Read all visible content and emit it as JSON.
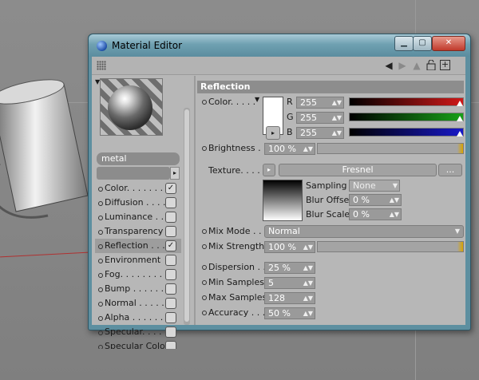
{
  "window": {
    "title": "Material Editor",
    "controls": {
      "minimize": "▁",
      "maximize": "▢",
      "close": "✕"
    }
  },
  "material": {
    "name": "metal"
  },
  "channels": [
    {
      "label": "Color. . . . . . . .",
      "checked": true
    },
    {
      "label": "Diffusion . . . . .",
      "checked": false
    },
    {
      "label": "Luminance . . . .",
      "checked": false
    },
    {
      "label": "Transparency",
      "checked": false
    },
    {
      "label": "Reflection . . . .",
      "checked": true
    },
    {
      "label": "Environment",
      "checked": false
    },
    {
      "label": "Fog. . . . . . . . .",
      "checked": false
    },
    {
      "label": "Bump . . . . . . .",
      "checked": false
    },
    {
      "label": "Normal . . . . . .",
      "checked": false
    },
    {
      "label": "Alpha . . . . . . .",
      "checked": false
    },
    {
      "label": "Specular. . . . . .",
      "checked": false
    },
    {
      "label": "Specular Color",
      "checked": false
    }
  ],
  "section": {
    "title": "Reflection"
  },
  "color": {
    "label": "Color. . . . .",
    "r_label": "R",
    "g_label": "G",
    "b_label": "B",
    "r": "255",
    "g": "255",
    "b": "255",
    "r_color": "#d01818",
    "g_color": "#18a018",
    "b_color": "#1818c8",
    "swatch": "#ffffff"
  },
  "brightness": {
    "label": "Brightness . . .",
    "value": "100 %",
    "level": 1.0
  },
  "texture": {
    "label": "Texture. . . . .",
    "shader": "Fresnel",
    "more": "...",
    "sampling_label": "Sampling",
    "sampling_value": "None",
    "blur_offset_label": "Blur Offset",
    "blur_offset_value": "0 %",
    "blur_scale_label": "Blur Scale",
    "blur_scale_value": "0 %"
  },
  "mix_mode": {
    "label": "Mix Mode . . . .",
    "value": "Normal"
  },
  "mix_strength": {
    "label": "Mix Strength",
    "value": "100 %",
    "level": 1.0
  },
  "dispersion": {
    "label": "Dispersion . . .",
    "value": "25 %"
  },
  "min_samples": {
    "label": "Min Samples",
    "value": "5"
  },
  "max_samples": {
    "label": "Max Samples",
    "value": "128"
  },
  "accuracy": {
    "label": "Accuracy . . . .",
    "value": "50 %"
  },
  "accent": "#d9a400"
}
